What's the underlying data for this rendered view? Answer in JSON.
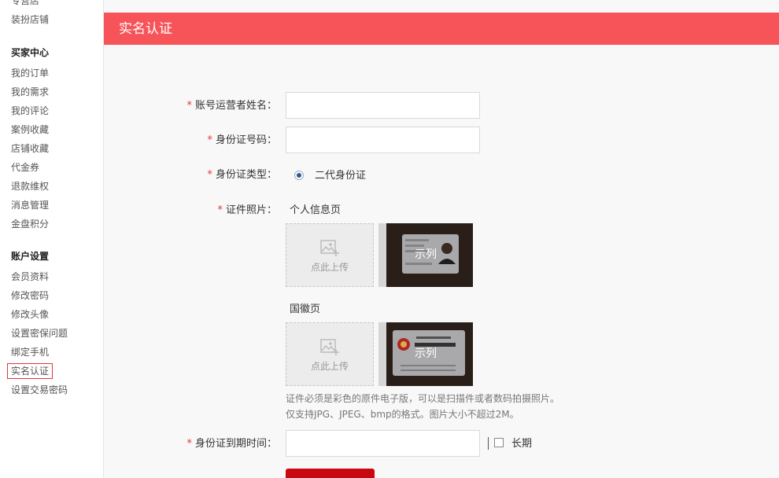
{
  "sidebar": {
    "top_items": [
      "专营店",
      "装扮店铺"
    ],
    "buyer_center": {
      "heading": "买家中心",
      "items": [
        "我的订单",
        "我的需求",
        "我的评论",
        "案例收藏",
        "店铺收藏",
        "代金券",
        "退款维权",
        "消息管理",
        "金盘积分"
      ]
    },
    "account_settings": {
      "heading": "账户设置",
      "items": [
        "会员资料",
        "修改密码",
        "修改头像",
        "设置密保问题",
        "绑定手机",
        "实名认证",
        "设置交易密码"
      ],
      "active": "实名认证"
    }
  },
  "page": {
    "title": "实名认证"
  },
  "form": {
    "required_mark": "*",
    "operator_name": {
      "label": "账号运营者姓名：",
      "value": ""
    },
    "id_number": {
      "label": "身份证号码：",
      "value": ""
    },
    "id_type": {
      "label": "身份证类型：",
      "option": "二代身份证",
      "selected": true
    },
    "photos": {
      "label": "证件照片：",
      "personal_page": {
        "label": "个人信息页",
        "upload_text": "点此上传",
        "sample_text": "示列"
      },
      "emblem_page": {
        "label": "国徽页",
        "upload_text": "点此上传",
        "sample_text": "示列"
      },
      "notes": [
        "证件必须是彩色的原件电子版，可以是扫描件或者数码拍摄照片。",
        "仅支持JPG、JPEG、bmp的格式。图片大小不超过2M。"
      ]
    },
    "expiry": {
      "label": "身份证到期时间：",
      "value": "",
      "divider": "|",
      "long_term_label": "长期",
      "long_term_checked": false
    }
  },
  "colors": {
    "title_bar": "#f7545a",
    "required": "#e0373c",
    "submit": "#c9070f",
    "sidebar_active_border": "#e0373c"
  },
  "icons": [
    "upload-image-icon",
    "radio-selected-icon",
    "checkbox-icon"
  ]
}
